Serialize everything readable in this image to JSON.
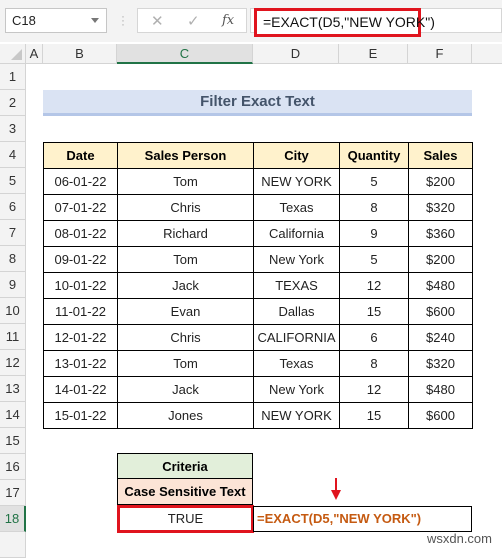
{
  "formula_bar": {
    "name_box": "C18",
    "cancel_icon": "✕",
    "enter_icon": "✓",
    "fx_label": "fx",
    "formula": "=EXACT(D5,\"NEW YORK\")"
  },
  "columns": [
    "A",
    "B",
    "C",
    "D",
    "E",
    "F"
  ],
  "selected_column": "C",
  "rows": [
    "1",
    "2",
    "3",
    "4",
    "5",
    "6",
    "7",
    "8",
    "9",
    "10",
    "11",
    "12",
    "13",
    "14",
    "15",
    "16",
    "17",
    "18"
  ],
  "selected_row": "18",
  "title": "Filter Exact Text",
  "table": {
    "headers": [
      "Date",
      "Sales Person",
      "City",
      "Quantity",
      "Sales"
    ],
    "rows": [
      [
        "06-01-22",
        "Tom",
        "NEW YORK",
        "5",
        "$200"
      ],
      [
        "07-01-22",
        "Chris",
        "Texas",
        "8",
        "$320"
      ],
      [
        "08-01-22",
        "Richard",
        "California",
        "9",
        "$360"
      ],
      [
        "09-01-22",
        "Tom",
        "New York",
        "5",
        "$200"
      ],
      [
        "10-01-22",
        "Jack",
        "TEXAS",
        "12",
        "$480"
      ],
      [
        "11-01-22",
        "Evan",
        "Dallas",
        "15",
        "$600"
      ],
      [
        "12-01-22",
        "Chris",
        "CALIFORNIA",
        "6",
        "$240"
      ],
      [
        "13-01-22",
        "Tom",
        "Texas",
        "8",
        "$320"
      ],
      [
        "14-01-22",
        "Jack",
        "New York",
        "12",
        "$480"
      ],
      [
        "15-01-22",
        "Jones",
        "NEW YORK",
        "15",
        "$600"
      ]
    ]
  },
  "criteria": {
    "header": "Criteria",
    "subheader": "Case Sensitive Text",
    "result": "TRUE",
    "formula_display": "=EXACT(D5,\"NEW YORK\")"
  },
  "watermark": "wsxdn.com",
  "colors": {
    "highlight_red": "#e0141e",
    "excel_green": "#217346",
    "table_header_bg": "#fff2cc",
    "title_bg": "#dae3f3",
    "criteria_header_bg": "#e2efda",
    "criteria_sub_bg": "#fce4d6",
    "formula_text": "#c55a11"
  }
}
